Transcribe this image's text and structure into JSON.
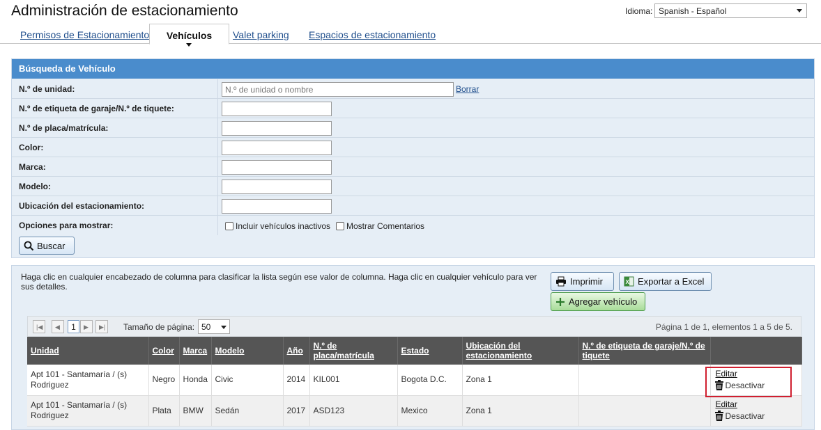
{
  "header": {
    "title": "Administración de estacionamiento",
    "language_label": "Idioma:",
    "language_value": "Spanish - Español"
  },
  "tabs": [
    {
      "label": "Permisos de Estacionamiento",
      "active": false
    },
    {
      "label": "Vehículos",
      "active": true
    },
    {
      "label": "Valet parking",
      "active": false
    },
    {
      "label": "Espacios de estacionamiento",
      "active": false
    }
  ],
  "search": {
    "title": "Búsqueda de Vehículo",
    "fields": [
      {
        "label": "N.º de unidad:",
        "value": "",
        "placeholder": "N.º de unidad o nombre"
      },
      {
        "label": "N.º de etiqueta de garaje/N.º de tiquete:",
        "value": ""
      },
      {
        "label": "N.º de placa/matrícula:",
        "value": ""
      },
      {
        "label": "Color:",
        "value": ""
      },
      {
        "label": "Marca:",
        "value": ""
      },
      {
        "label": "Modelo:",
        "value": ""
      },
      {
        "label": "Ubicación del estacionamiento:",
        "value": ""
      }
    ],
    "clear_label": "Borrar",
    "options_label": "Opciones para mostrar:",
    "option_inactive": "Incluir vehículos inactivos",
    "option_comments": "Mostrar Comentarios",
    "search_button": "Buscar"
  },
  "results": {
    "help_text": "Haga clic en cualquier encabezado de columna para clasificar la lista según ese valor de columna. Haga clic en cualquier vehículo para ver sus detalles.",
    "print_button": "Imprimir",
    "export_button": "Exportar a Excel",
    "add_button": "Agregar vehículo",
    "pager": {
      "current_page": "1",
      "page_size_label": "Tamaño de página:",
      "page_size": "50",
      "info": "Página 1 de 1, elementos 1 a 5 de 5."
    },
    "columns": [
      "Unidad",
      "Color",
      "Marca",
      "Modelo",
      "Año",
      "N.º de placa/matrícula",
      "Estado",
      "Ubicación del estacionamiento",
      "N.º de etiqueta de garaje/N.º de tiquete"
    ],
    "rows": [
      {
        "unit": "Apt 101 - Santamaría / (s) Rodriguez",
        "color": "Negro",
        "make": "Honda",
        "model": "Civic",
        "year": "2014",
        "plate": "KIL001",
        "state": "Bogota D.C.",
        "location": "Zona 1",
        "tag": "",
        "edit": "Editar",
        "deactivate": "Desactivar"
      },
      {
        "unit": "Apt 101 - Santamaría / (s) Rodriguez",
        "color": "Plata",
        "make": "BMW",
        "model": "Sedán",
        "year": "2017",
        "plate": "ASD123",
        "state": "Mexico",
        "location": "Zona 1",
        "tag": "",
        "edit": "Editar",
        "deactivate": "Desactivar"
      }
    ]
  },
  "colors": {
    "panel_header": "#4a8ccc",
    "panel_bg": "#e6eef6",
    "grid_header": "#555555",
    "highlight": "#d01f2f",
    "link": "#1f4e8c"
  }
}
